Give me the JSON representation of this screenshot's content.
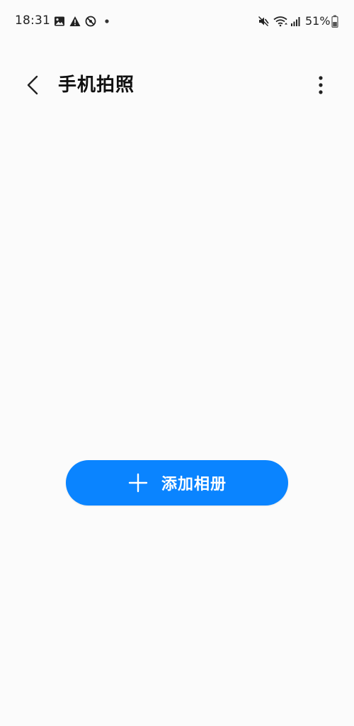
{
  "status_bar": {
    "time": "18:31",
    "battery": "51%",
    "icons": [
      "gallery-icon",
      "warning-icon",
      "no-disturb-icon",
      "dot-icon",
      "mute-icon",
      "wifi-icon",
      "signal-icon",
      "battery-icon"
    ]
  },
  "app_bar": {
    "title": "手机拍照",
    "back_icon": "chevron-left-icon",
    "more_icon": "more-vertical-icon"
  },
  "main": {
    "add_album_label": "添加相册",
    "add_icon": "plus-icon"
  },
  "colors": {
    "background": "#fbfbfb",
    "accent": "#0a84ff",
    "button_text": "#ffffff"
  }
}
